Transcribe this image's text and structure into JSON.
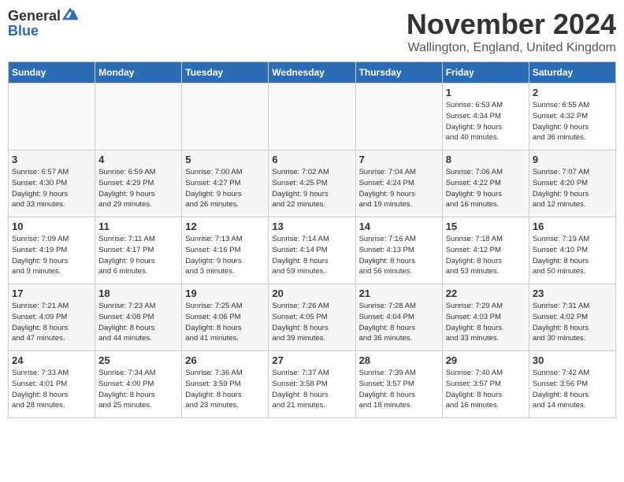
{
  "logo": {
    "line1": "General",
    "line2": "Blue"
  },
  "title": "November 2024",
  "location": "Wallington, England, United Kingdom",
  "days_header": [
    "Sunday",
    "Monday",
    "Tuesday",
    "Wednesday",
    "Thursday",
    "Friday",
    "Saturday"
  ],
  "weeks": [
    [
      {
        "day": "",
        "info": ""
      },
      {
        "day": "",
        "info": ""
      },
      {
        "day": "",
        "info": ""
      },
      {
        "day": "",
        "info": ""
      },
      {
        "day": "",
        "info": ""
      },
      {
        "day": "1",
        "info": "Sunrise: 6:53 AM\nSunset: 4:34 PM\nDaylight: 9 hours\nand 40 minutes."
      },
      {
        "day": "2",
        "info": "Sunrise: 6:55 AM\nSunset: 4:32 PM\nDaylight: 9 hours\nand 36 minutes."
      }
    ],
    [
      {
        "day": "3",
        "info": "Sunrise: 6:57 AM\nSunset: 4:30 PM\nDaylight: 9 hours\nand 33 minutes."
      },
      {
        "day": "4",
        "info": "Sunrise: 6:59 AM\nSunset: 4:29 PM\nDaylight: 9 hours\nand 29 minutes."
      },
      {
        "day": "5",
        "info": "Sunrise: 7:00 AM\nSunset: 4:27 PM\nDaylight: 9 hours\nand 26 minutes."
      },
      {
        "day": "6",
        "info": "Sunrise: 7:02 AM\nSunset: 4:25 PM\nDaylight: 9 hours\nand 22 minutes."
      },
      {
        "day": "7",
        "info": "Sunrise: 7:04 AM\nSunset: 4:24 PM\nDaylight: 9 hours\nand 19 minutes."
      },
      {
        "day": "8",
        "info": "Sunrise: 7:06 AM\nSunset: 4:22 PM\nDaylight: 9 hours\nand 16 minutes."
      },
      {
        "day": "9",
        "info": "Sunrise: 7:07 AM\nSunset: 4:20 PM\nDaylight: 9 hours\nand 12 minutes."
      }
    ],
    [
      {
        "day": "10",
        "info": "Sunrise: 7:09 AM\nSunset: 4:19 PM\nDaylight: 9 hours\nand 9 minutes."
      },
      {
        "day": "11",
        "info": "Sunrise: 7:11 AM\nSunset: 4:17 PM\nDaylight: 9 hours\nand 6 minutes."
      },
      {
        "day": "12",
        "info": "Sunrise: 7:13 AM\nSunset: 4:16 PM\nDaylight: 9 hours\nand 3 minutes."
      },
      {
        "day": "13",
        "info": "Sunrise: 7:14 AM\nSunset: 4:14 PM\nDaylight: 8 hours\nand 59 minutes."
      },
      {
        "day": "14",
        "info": "Sunrise: 7:16 AM\nSunset: 4:13 PM\nDaylight: 8 hours\nand 56 minutes."
      },
      {
        "day": "15",
        "info": "Sunrise: 7:18 AM\nSunset: 4:12 PM\nDaylight: 8 hours\nand 53 minutes."
      },
      {
        "day": "16",
        "info": "Sunrise: 7:19 AM\nSunset: 4:10 PM\nDaylight: 8 hours\nand 50 minutes."
      }
    ],
    [
      {
        "day": "17",
        "info": "Sunrise: 7:21 AM\nSunset: 4:09 PM\nDaylight: 8 hours\nand 47 minutes."
      },
      {
        "day": "18",
        "info": "Sunrise: 7:23 AM\nSunset: 4:08 PM\nDaylight: 8 hours\nand 44 minutes."
      },
      {
        "day": "19",
        "info": "Sunrise: 7:25 AM\nSunset: 4:06 PM\nDaylight: 8 hours\nand 41 minutes."
      },
      {
        "day": "20",
        "info": "Sunrise: 7:26 AM\nSunset: 4:05 PM\nDaylight: 8 hours\nand 39 minutes."
      },
      {
        "day": "21",
        "info": "Sunrise: 7:28 AM\nSunset: 4:04 PM\nDaylight: 8 hours\nand 36 minutes."
      },
      {
        "day": "22",
        "info": "Sunrise: 7:29 AM\nSunset: 4:03 PM\nDaylight: 8 hours\nand 33 minutes."
      },
      {
        "day": "23",
        "info": "Sunrise: 7:31 AM\nSunset: 4:02 PM\nDaylight: 8 hours\nand 30 minutes."
      }
    ],
    [
      {
        "day": "24",
        "info": "Sunrise: 7:33 AM\nSunset: 4:01 PM\nDaylight: 8 hours\nand 28 minutes."
      },
      {
        "day": "25",
        "info": "Sunrise: 7:34 AM\nSunset: 4:00 PM\nDaylight: 8 hours\nand 25 minutes."
      },
      {
        "day": "26",
        "info": "Sunrise: 7:36 AM\nSunset: 3:59 PM\nDaylight: 8 hours\nand 23 minutes."
      },
      {
        "day": "27",
        "info": "Sunrise: 7:37 AM\nSunset: 3:58 PM\nDaylight: 8 hours\nand 21 minutes."
      },
      {
        "day": "28",
        "info": "Sunrise: 7:39 AM\nSunset: 3:57 PM\nDaylight: 8 hours\nand 18 minutes."
      },
      {
        "day": "29",
        "info": "Sunrise: 7:40 AM\nSunset: 3:57 PM\nDaylight: 8 hours\nand 16 minutes."
      },
      {
        "day": "30",
        "info": "Sunrise: 7:42 AM\nSunset: 3:56 PM\nDaylight: 8 hours\nand 14 minutes."
      }
    ]
  ]
}
